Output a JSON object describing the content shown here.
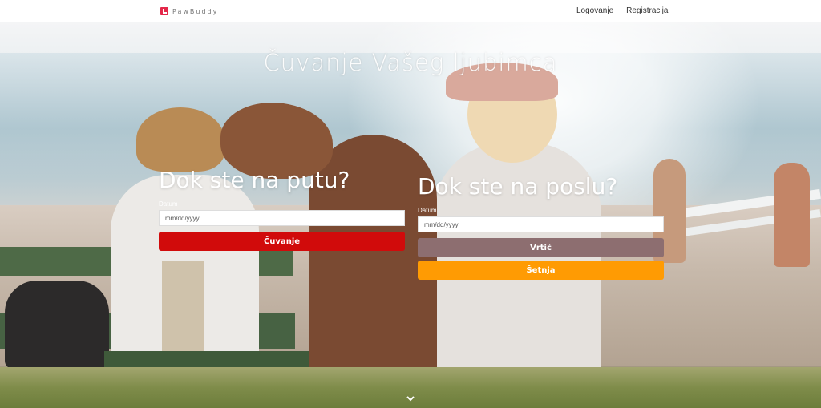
{
  "nav": {
    "brand": "PawBuddy",
    "links": [
      "Logovanje",
      "Registracija"
    ]
  },
  "hero": {
    "title": "Čuvanje Vašeg ljubimca"
  },
  "travel": {
    "heading": "Dok ste na putu?",
    "date_label": "Datum",
    "date_placeholder": "mm/dd/yyyy",
    "button": "Čuvanje"
  },
  "work": {
    "heading": "Dok ste na poslu?",
    "date_label": "Datum",
    "date_placeholder": "mm/dd/yyyy",
    "buttons": [
      "Vrtić",
      "Šetnja"
    ]
  },
  "icons": {
    "logo": "pawbuddy-logo-icon",
    "scroll": "chevron-down-icon"
  },
  "colors": {
    "brand": "#e4284a",
    "cuvanje": "#d10b0b",
    "vrtic": "#8d6e70",
    "setnja": "#ff9b03"
  }
}
